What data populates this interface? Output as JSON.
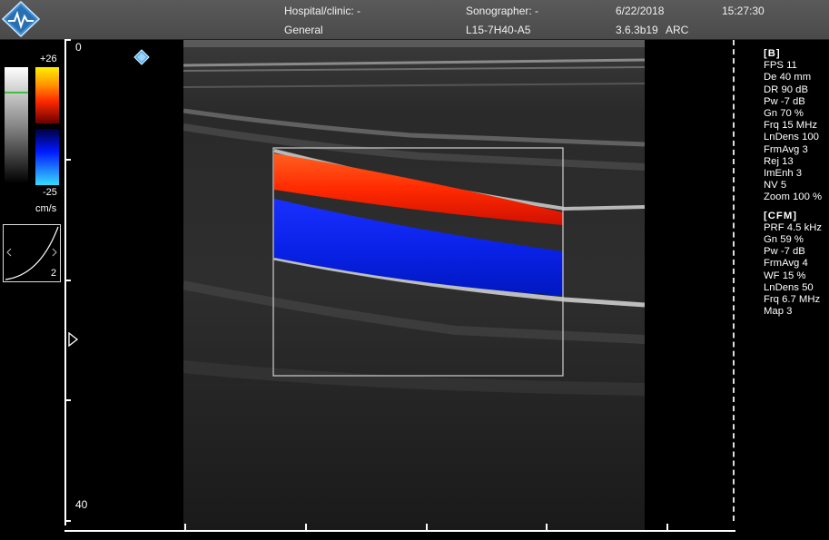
{
  "header": {
    "hospital": "Hospital/clinic: -",
    "department": "General",
    "sonographer": "Sonographer: -",
    "probe": "L15-7H40-A5",
    "date": "6/22/2018",
    "version": "3.6.3b19",
    "mode": "ARC",
    "time": "15:27:30"
  },
  "colorbar": {
    "top_value": "+26",
    "bottom_value": "-25",
    "unit": "cm/s"
  },
  "curve": {
    "number": "2"
  },
  "depth": {
    "top": "0",
    "bottom": "40"
  },
  "b_params": {
    "title": "[B]",
    "items": [
      "FPS 11",
      "De 40 mm",
      "DR 90 dB",
      "Pw -7 dB",
      "Gn 70 %",
      "Frq 15 MHz",
      "LnDens 100",
      "FrmAvg 3",
      "Rej 13",
      "ImEnh 3",
      "NV 5",
      "Zoom 100 %"
    ]
  },
  "cfm_params": {
    "title": "[CFM]",
    "items": [
      "PRF 4.5 kHz",
      "Gn 59 %",
      "Pw -7 dB",
      "FrmAvg 4",
      "WF 15 %",
      "LnDens 50",
      "Frq 6.7 MHz",
      "Map 3"
    ]
  }
}
